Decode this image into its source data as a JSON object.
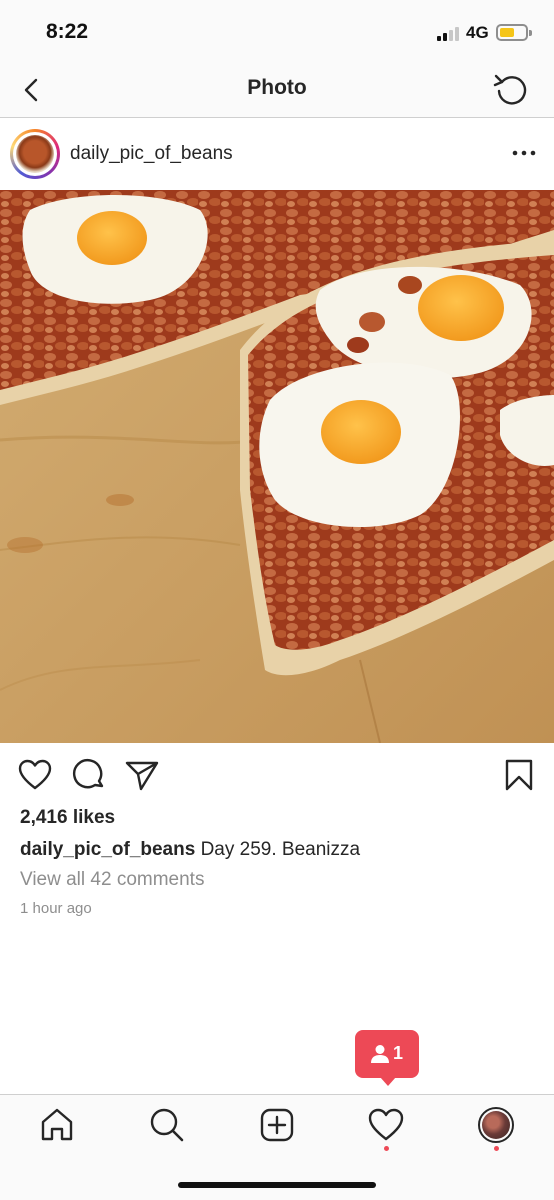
{
  "status_bar": {
    "time": "8:22",
    "network": "4G"
  },
  "header": {
    "title": "Photo",
    "back_icon": "chevron-left-icon",
    "refresh_icon": "refresh-icon"
  },
  "post": {
    "username": "daily_pic_of_beans",
    "more_icon": "ellipsis-icon",
    "photo_alt": "Pizza topped with baked beans and fried eggs",
    "likes": "2,416 likes",
    "caption": {
      "username": "daily_pic_of_beans",
      "text": "Day 259. Beanizza"
    },
    "view_comments": "View all 42 comments",
    "time_ago": "1 hour ago"
  },
  "activity_badge": {
    "count": "1",
    "icon": "person-icon",
    "color": "#ed4956"
  },
  "tab_bar": {
    "items": [
      "home-icon",
      "search-icon",
      "new-post-icon",
      "heart-icon",
      "profile-avatar"
    ]
  },
  "colors": {
    "accent": "#ed4956",
    "text": "#262626",
    "muted": "#8e8e8e"
  }
}
